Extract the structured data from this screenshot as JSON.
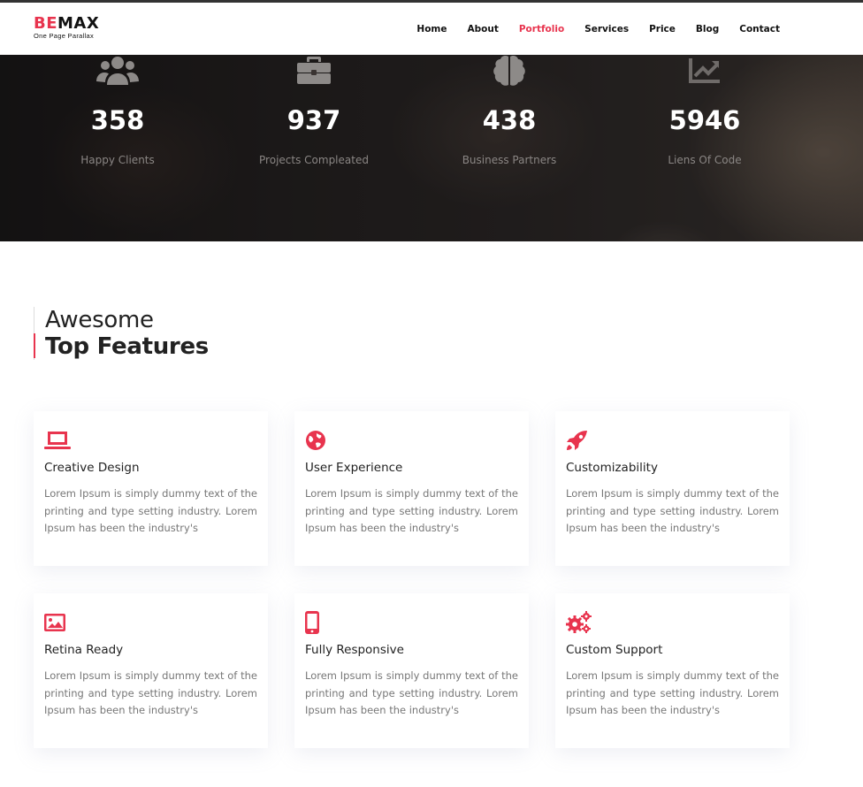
{
  "brand": {
    "logo_accent": "BE",
    "logo_rest": "MAX",
    "tagline": "One Page Parallax"
  },
  "nav": {
    "items": [
      {
        "label": "Home",
        "active": false
      },
      {
        "label": "About",
        "active": false
      },
      {
        "label": "Portfolio",
        "active": true
      },
      {
        "label": "Services",
        "active": false
      },
      {
        "label": "Price",
        "active": false
      },
      {
        "label": "Blog",
        "active": false
      },
      {
        "label": "Contact",
        "active": false
      }
    ]
  },
  "stats": [
    {
      "icon": "users-icon",
      "value": "358",
      "label": "Happy Clients"
    },
    {
      "icon": "briefcase-icon",
      "value": "937",
      "label": "Projects Compleated"
    },
    {
      "icon": "brain-icon",
      "value": "438",
      "label": "Business Partners"
    },
    {
      "icon": "chart-line-icon",
      "value": "5946",
      "label": "Liens Of Code"
    }
  ],
  "section": {
    "title_light": "Awesome",
    "title_bold": "Top Features"
  },
  "features": [
    {
      "icon": "laptop-icon",
      "title": "Creative Design",
      "text": "Lorem Ipsum is simply dummy text of the printing and type setting industry. Lorem Ipsum has been the industry's"
    },
    {
      "icon": "globe-icon",
      "title": "User Experience",
      "text": "Lorem Ipsum is simply dummy text of the printing and type setting industry. Lorem Ipsum has been the industry's"
    },
    {
      "icon": "rocket-icon",
      "title": "Customizability",
      "text": "Lorem Ipsum is simply dummy text of the printing and type setting industry. Lorem Ipsum has been the industry's"
    },
    {
      "icon": "image-icon",
      "title": "Retina Ready",
      "text": "Lorem Ipsum is simply dummy text of the printing and type setting industry. Lorem Ipsum has been the industry's"
    },
    {
      "icon": "mobile-icon",
      "title": "Fully Responsive",
      "text": "Lorem Ipsum is simply dummy text of the printing and type setting industry. Lorem Ipsum has been the industry's"
    },
    {
      "icon": "cogs-icon",
      "title": "Custom Support",
      "text": "Lorem Ipsum is simply dummy text of the printing and type setting industry. Lorem Ipsum has been the industry's"
    }
  ],
  "colors": {
    "accent": "#e8344e",
    "stat_icon": "#8d8a88",
    "stat_label": "#8a8684"
  }
}
